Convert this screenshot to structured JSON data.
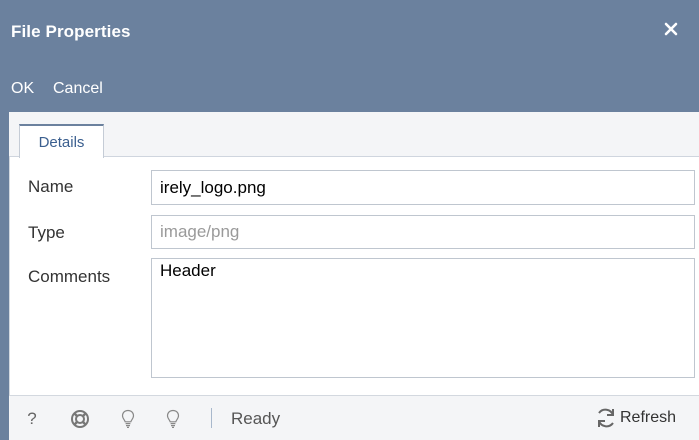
{
  "window": {
    "title": "File Properties",
    "close_icon": "close-icon"
  },
  "toolbar": {
    "ok_label": "OK",
    "cancel_label": "Cancel"
  },
  "tabs": [
    {
      "label": "Details",
      "active": true
    }
  ],
  "form": {
    "name_label": "Name",
    "name_value": "irely_logo.png",
    "type_label": "Type",
    "type_value": "image/png",
    "comments_label": "Comments",
    "comments_value": "Header"
  },
  "statusbar": {
    "icons": [
      "help-icon",
      "lifebuoy-icon",
      "lightbulb-icon",
      "lightbulb-icon"
    ],
    "help_glyph": "?",
    "status": "Ready",
    "refresh_label": "Refresh"
  },
  "colors": {
    "header": "#6b819e",
    "tab_text": "#3b5f8f"
  }
}
